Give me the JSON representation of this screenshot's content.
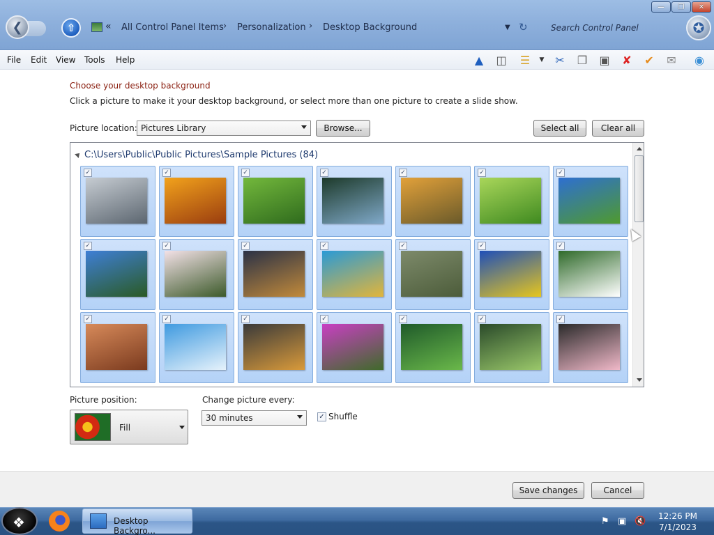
{
  "window": {
    "breadcrumb": [
      "All Control Panel Items",
      "Personalization",
      "Desktop Background"
    ],
    "search_placeholder": "Search Control Panel"
  },
  "menu": [
    "File",
    "Edit",
    "View",
    "Tools",
    "Help"
  ],
  "content": {
    "heading": "Choose your desktop background",
    "description": "Click a picture to make it your desktop background, or select more than one picture to create a slide show.",
    "picture_location_label": "Picture location:",
    "picture_location_value": "Pictures Library",
    "browse_label": "Browse...",
    "select_all_label": "Select all",
    "clear_all_label": "Clear all",
    "group_header": "C:\\Users\\Public\\Public Pictures\\Sample Pictures (84)",
    "thumbnails": [
      {
        "checked": true,
        "colors": [
          "#c6ccd2",
          "#5c6670"
        ]
      },
      {
        "checked": true,
        "colors": [
          "#f2a21c",
          "#9a3d0f"
        ]
      },
      {
        "checked": true,
        "colors": [
          "#73b83c",
          "#2f6b1d"
        ]
      },
      {
        "checked": true,
        "colors": [
          "#1d3a2a",
          "#7fa8c8"
        ]
      },
      {
        "checked": true,
        "colors": [
          "#e2a13a",
          "#6a5a2a"
        ]
      },
      {
        "checked": true,
        "colors": [
          "#a9d65a",
          "#3f8a20"
        ]
      },
      {
        "checked": true,
        "colors": [
          "#2e6fd1",
          "#4f9a2e"
        ]
      },
      {
        "checked": true,
        "colors": [
          "#3f7fd6",
          "#2a5a24"
        ]
      },
      {
        "checked": true,
        "colors": [
          "#f3e1e7",
          "#3c5a2a"
        ]
      },
      {
        "checked": true,
        "colors": [
          "#2a3146",
          "#c28a3a"
        ]
      },
      {
        "checked": true,
        "colors": [
          "#2a9ad6",
          "#e2b53a"
        ]
      },
      {
        "checked": true,
        "colors": [
          "#7d8a6a",
          "#4c5c3a"
        ]
      },
      {
        "checked": true,
        "colors": [
          "#1f4fb8",
          "#e6c61e"
        ]
      },
      {
        "checked": true,
        "colors": [
          "#2f6a2a",
          "#ffffff"
        ]
      },
      {
        "checked": true,
        "colors": [
          "#d78a5a",
          "#7a3a1e"
        ]
      },
      {
        "checked": true,
        "colors": [
          "#3f9ae0",
          "#e6f2fb"
        ]
      },
      {
        "checked": true,
        "colors": [
          "#3a3a3a",
          "#d99a3a"
        ]
      },
      {
        "checked": true,
        "colors": [
          "#c93fc3",
          "#3f6a2a"
        ]
      },
      {
        "checked": true,
        "colors": [
          "#1f5a2a",
          "#6ab84a"
        ]
      },
      {
        "checked": true,
        "colors": [
          "#2a4a2a",
          "#9ac86a"
        ]
      },
      {
        "checked": true,
        "colors": [
          "#2a2a2a",
          "#f0b8c8"
        ]
      }
    ],
    "picture_position_label": "Picture position:",
    "picture_position_value": "Fill",
    "change_every_label": "Change picture every:",
    "change_every_value": "30 minutes",
    "shuffle_label": "Shuffle",
    "shuffle_checked": true
  },
  "footer": {
    "save_label": "Save changes",
    "cancel_label": "Cancel"
  },
  "taskbar": {
    "task_label": "Desktop Backgro...",
    "time": "12:26 PM",
    "date": "7/1/2023"
  }
}
